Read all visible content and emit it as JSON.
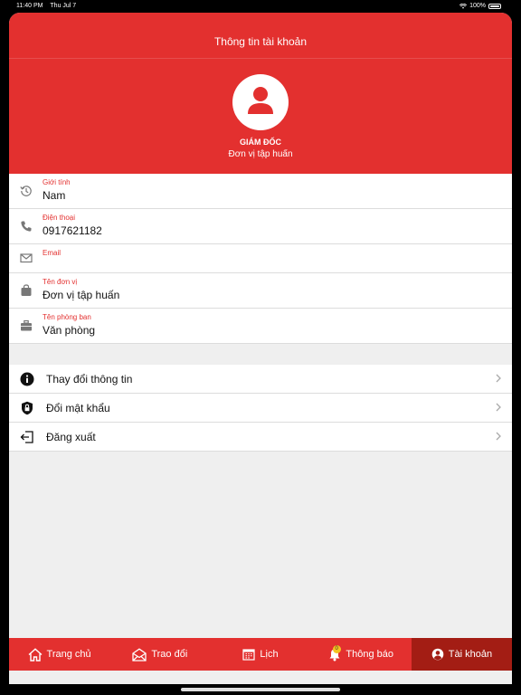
{
  "status_bar": {
    "time": "11:40 PM",
    "date": "Thu Jul 7",
    "battery": "100%"
  },
  "header": {
    "title": "Thông tin tài khoản",
    "role": "GIÁM ĐỐC",
    "unit": "Đơn vị tập huấn"
  },
  "info": [
    {
      "icon": "history-icon",
      "label": "Giới tính",
      "value": "Nam"
    },
    {
      "icon": "phone-icon",
      "label": "Điện thoại",
      "value": "0917621182"
    },
    {
      "icon": "mail-icon",
      "label": "Email",
      "value": ""
    },
    {
      "icon": "bag-icon",
      "label": "Tên đơn vị",
      "value": "Đơn vị tập huấn"
    },
    {
      "icon": "briefcase-icon",
      "label": "Tên phòng ban",
      "value": "Văn phòng"
    }
  ],
  "menu": [
    {
      "icon": "info-icon",
      "label": "Thay đổi thông tin"
    },
    {
      "icon": "shield-lock-icon",
      "label": "Đổi mật khẩu"
    },
    {
      "icon": "logout-icon",
      "label": "Đăng xuất"
    }
  ],
  "tabs": [
    {
      "icon": "home-icon",
      "label": "Trang chủ",
      "active": false
    },
    {
      "icon": "mail-open-icon",
      "label": "Trao đổi",
      "active": false
    },
    {
      "icon": "calendar-icon",
      "label": "Lịch",
      "active": false
    },
    {
      "icon": "bell-icon",
      "label": "Thông báo",
      "active": false,
      "badge": "0"
    },
    {
      "icon": "user-circle-icon",
      "label": "Tài khoản",
      "active": true
    }
  ],
  "colors": {
    "primary": "#e3302f",
    "active_tab": "#a31d14",
    "badge": "#f4c321"
  }
}
